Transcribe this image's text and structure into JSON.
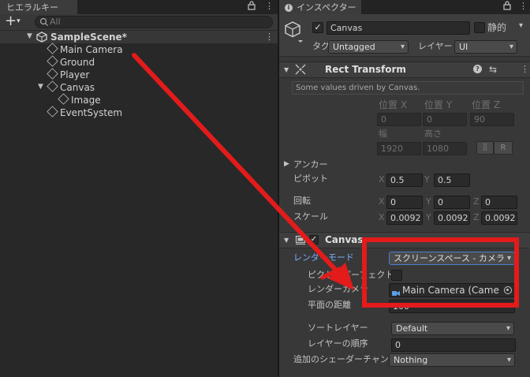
{
  "hierarchy": {
    "tab_title": "ヒエラルキー",
    "search_placeholder": "All",
    "scene": "SampleScene*",
    "items": [
      "Main Camera",
      "Ground",
      "Player",
      "Canvas",
      "Image",
      "EventSystem"
    ]
  },
  "inspector": {
    "tab_title": "インスペクター",
    "object_name": "Canvas",
    "static_label": "静的",
    "tag_label": "タグ",
    "tag_value": "Untagged",
    "layer_label": "レイヤー",
    "layer_value": "UI",
    "rect_transform": {
      "title": "Rect Transform",
      "notice": "Some values driven by Canvas.",
      "pos_x_label": "位置 X",
      "pos_y_label": "位置 Y",
      "pos_z_label": "位置 Z",
      "pos_x": "0",
      "pos_y": "0",
      "pos_z": "90",
      "width_label": "幅",
      "height_label": "高さ",
      "width": "1920",
      "height": "1080",
      "r_button": "R",
      "anchor_label": "アンカー",
      "pivot_label": "ピボット",
      "pivot_x_label": "X",
      "pivot_x": "0.5",
      "pivot_y_label": "Y",
      "pivot_y": "0.5",
      "rotation_label": "回転",
      "rot_x": "0",
      "rot_y": "0",
      "rot_z": "0",
      "scale_label": "スケール",
      "scale_x": "0.0092",
      "scale_y": "0.0092",
      "scale_z": "0.0092",
      "x": "X",
      "y": "Y",
      "z": "Z"
    },
    "canvas": {
      "title": "Canvas",
      "render_mode_label": "レンダーモード",
      "render_mode_value": "スクリーンスペース - カメラ",
      "pixel_perfect_label": "ピクセルパーフェクト",
      "render_camera_label": "レンダーカメラ",
      "render_camera_value": "Main Camera (Came",
      "plane_distance_label": "平面の距離",
      "plane_distance_value": "100",
      "sorting_layer_label": "ソートレイヤー",
      "sorting_layer_value": "Default",
      "order_label": "レイヤーの順序",
      "order_value": "0",
      "shader_channels_label": "追加のシェーダーチャンネル",
      "shader_channels_value": "Nothing"
    }
  },
  "annotation": {
    "arrow_color": "#e31b1b",
    "highlight_color": "#e31b1b"
  }
}
